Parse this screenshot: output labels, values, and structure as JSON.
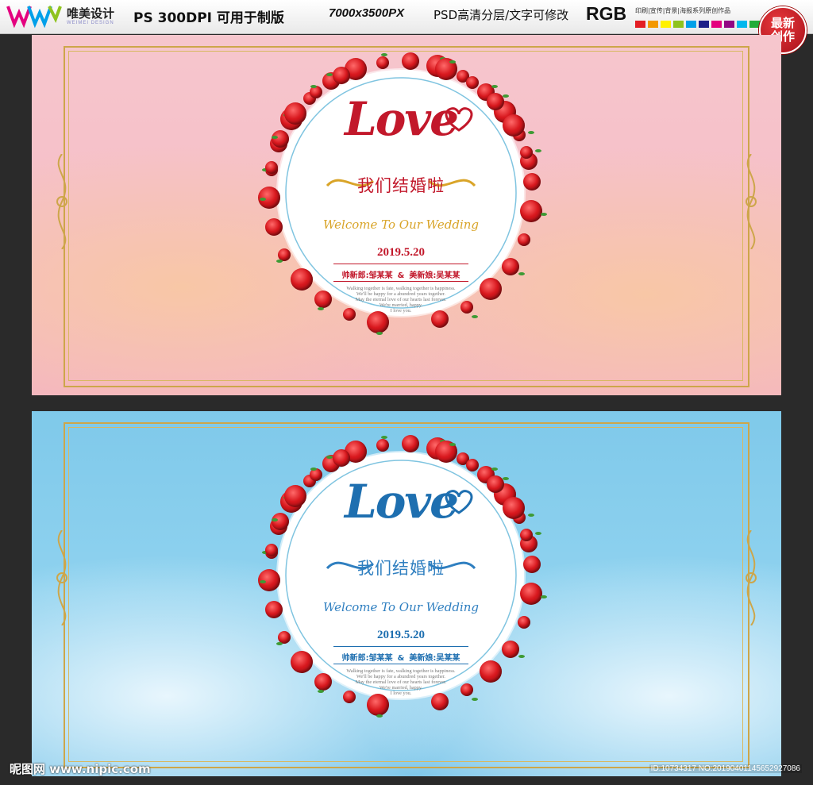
{
  "header": {
    "brand_name": "唯美设计",
    "brand_sub": "WEIMEI DESIGN",
    "specs": "PS 300DPI 可用于制版",
    "dimensions": "7000x3500PX",
    "psd_note": "PSD高清分层/文字可修改",
    "color_mode": "RGB",
    "description": "印刷|宣传|背景|海报系列原创作品",
    "swatch_colors": [
      "#e31e24",
      "#f39800",
      "#fff100",
      "#8fc31f",
      "#00a0e9",
      "#1d2088",
      "#e4007f",
      "#920783",
      "#00b7ee",
      "#22ac38",
      "#f8b551",
      "#e60012"
    ],
    "badge_line1": "最新",
    "badge_line2": "创作"
  },
  "panels": [
    {
      "theme": "pink",
      "love_text": "Love",
      "title": "我们结婚啦",
      "welcome": "Welcome To Our Wedding",
      "date": "2019.5.20",
      "groom": "帅新郎:邹某某",
      "amp": "&",
      "bride": "美新娘:吴某某",
      "blurb": [
        "Walking together is fate, walking together is happiness.",
        "We'll be happy for a abundred years together.",
        "May the eternal love of our hearts last forever.",
        "We're married, happy.",
        "I love you."
      ],
      "colors": {
        "love": "#c2182b",
        "title": "#c2182b",
        "welcome": "#d9a428",
        "date": "#c2182b",
        "names": "#c2182b",
        "filigree": "#d9a428"
      }
    },
    {
      "theme": "blue",
      "love_text": "Love",
      "title": "我们结婚啦",
      "welcome": "Welcome To Our Wedding",
      "date": "2019.5.20",
      "groom": "帅新郎:邹某某",
      "amp": "&",
      "bride": "美新娘:吴某某",
      "blurb": [
        "Walking together is fate, walking together is happiness.",
        "We'll be happy for a abundred years together.",
        "May the eternal love of our hearts last forever.",
        "We're married, happy.",
        "I love you."
      ],
      "colors": {
        "love": "#1e6fb0",
        "title": "#2f7fc0",
        "welcome": "#2f7fc0",
        "date": "#1e6fb0",
        "names": "#1e6fb0",
        "filigree": "#2f7fc0"
      }
    }
  ],
  "footer": {
    "site": "昵图网 www.nipic.com",
    "id_text": "ID:10734317 NO:20190401145652927086"
  }
}
